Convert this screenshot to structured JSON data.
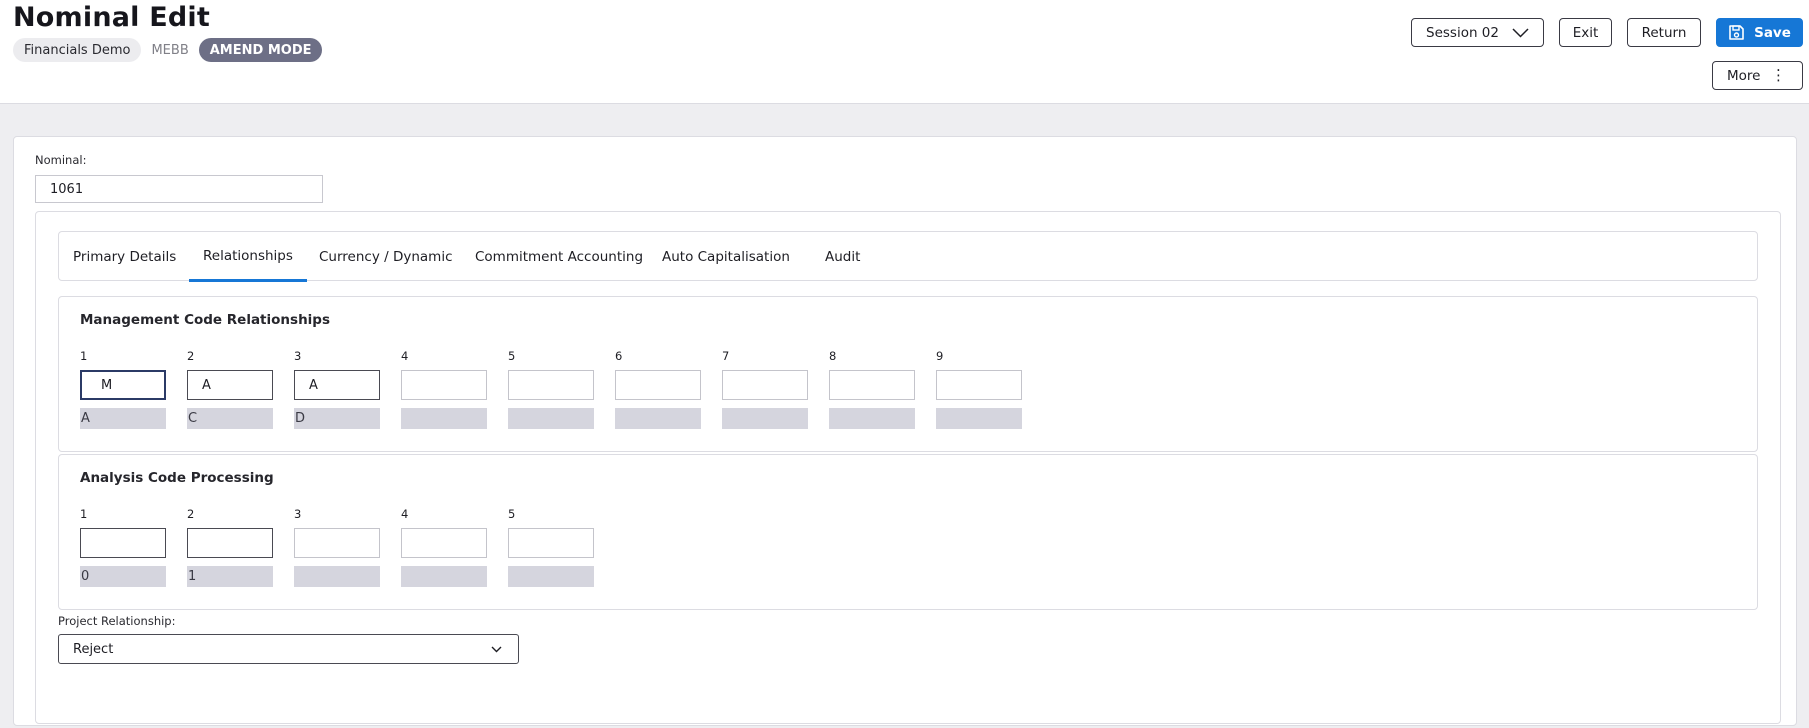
{
  "header": {
    "title": "Nominal Edit",
    "company": "Financials Demo",
    "company_code": "MEBB",
    "mode": "AMEND MODE"
  },
  "toolbar": {
    "session_label": "Session 02",
    "exit_label": "Exit",
    "return_label": "Return",
    "save_label": "Save",
    "more_label": "More"
  },
  "nominal": {
    "label": "Nominal:",
    "value": "1061"
  },
  "tabs": [
    {
      "label": "Primary Details"
    },
    {
      "label": "Relationships",
      "active": true
    },
    {
      "label": "Currency / Dynamic"
    },
    {
      "label": "Commitment Accounting"
    },
    {
      "label": "Auto Capitalisation"
    },
    {
      "label": "Audit"
    }
  ],
  "management": {
    "title": "Management Code Relationships",
    "fields": [
      {
        "num": "1",
        "value": "M",
        "desc": "A"
      },
      {
        "num": "2",
        "value": "A",
        "desc": "C"
      },
      {
        "num": "3",
        "value": "A",
        "desc": "D"
      },
      {
        "num": "4",
        "value": "",
        "desc": ""
      },
      {
        "num": "5",
        "value": "",
        "desc": ""
      },
      {
        "num": "6",
        "value": "",
        "desc": ""
      },
      {
        "num": "7",
        "value": "",
        "desc": ""
      },
      {
        "num": "8",
        "value": "",
        "desc": ""
      },
      {
        "num": "9",
        "value": "",
        "desc": ""
      }
    ]
  },
  "analysis": {
    "title": "Analysis Code Processing",
    "fields": [
      {
        "num": "1",
        "value": "",
        "desc": "0"
      },
      {
        "num": "2",
        "value": "",
        "desc": "1"
      },
      {
        "num": "3",
        "value": "",
        "desc": ""
      },
      {
        "num": "4",
        "value": "",
        "desc": ""
      },
      {
        "num": "5",
        "value": "",
        "desc": ""
      }
    ]
  },
  "project": {
    "label": "Project Relationship:",
    "value": "Reject"
  },
  "colors": {
    "accent": "#1677d6",
    "mode_badge": "#6d6f86",
    "desc_bg": "#d5d5de",
    "page_bg": "#eeeef1"
  },
  "icons": {
    "session": "chevron-down-icon",
    "save": "floppy-disk-icon",
    "more": "vertical-dots-icon",
    "select": "chevron-down-icon"
  }
}
